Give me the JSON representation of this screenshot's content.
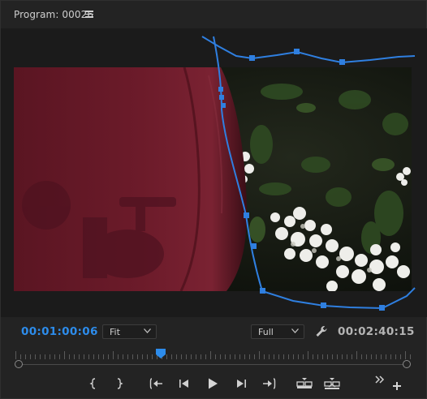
{
  "panel": {
    "title": "Program: 00026",
    "menu_icon": "hamburger-menu-icon"
  },
  "timecode": {
    "current": "00:01:00:06",
    "duration": "00:02:40:15"
  },
  "zoom_select": {
    "value": "Fit"
  },
  "quality_select": {
    "value": "Full"
  },
  "colors": {
    "accent": "#2d8ceb",
    "mask_path": "#2f7fe0",
    "panel_bg": "#232323",
    "car_red": "#6b1a28"
  },
  "controls": [
    {
      "name": "mark-in-button",
      "icon": "mark-in-icon"
    },
    {
      "name": "mark-out-button",
      "icon": "mark-out-icon"
    },
    {
      "name": "go-to-in-button",
      "icon": "go-to-in-icon"
    },
    {
      "name": "step-back-button",
      "icon": "step-back-icon"
    },
    {
      "name": "play-button",
      "icon": "play-icon"
    },
    {
      "name": "step-forward-button",
      "icon": "step-forward-icon"
    },
    {
      "name": "go-to-out-button",
      "icon": "go-to-out-icon"
    },
    {
      "name": "lift-button",
      "icon": "lift-icon"
    },
    {
      "name": "extract-button",
      "icon": "extract-icon"
    },
    {
      "name": "more-controls-button",
      "icon": "double-chevron-right-icon"
    },
    {
      "name": "button-editor-button",
      "icon": "plus-icon"
    }
  ]
}
